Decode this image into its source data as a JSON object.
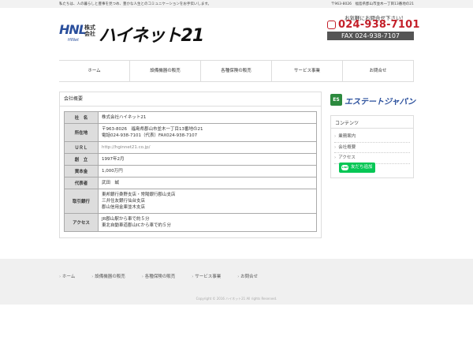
{
  "topbar": {
    "tagline": "私たちは、人の暮らしと豊事を見つめ、豊かな人生とのコミュニケーションをお手伝いします。",
    "address": "〒963-8026　福島県郡山市並木一丁目13番地の21"
  },
  "logo": {
    "mark": "HNL",
    "mark_sub": "HINet",
    "kabushiki": "株式会社",
    "name": "ハイネット21"
  },
  "contact": {
    "note": "お気軽にお問合せ下さい！",
    "phone": "024-938-7101",
    "fax": "FAX 024-938-7107"
  },
  "nav": [
    "ホーム",
    "設備機器の販売",
    "各種保険の販売",
    "サービス事業",
    "お問合せ"
  ],
  "main": {
    "heading": "会社概要",
    "rows": [
      {
        "label": "社　名",
        "lines": [
          "株式会社ハイネット21"
        ]
      },
      {
        "label": "所在地",
        "lines": [
          "〒963-8026　福島県郡山市並木一丁目13番地の21",
          "電話024-938-7101（代表）FAX024-938-7107"
        ]
      },
      {
        "label": "ＵＲＬ",
        "lines": [
          "http://hginnet21.co.jp/"
        ]
      },
      {
        "label": "創　立",
        "lines": [
          "1997年2月"
        ]
      },
      {
        "label": "資本金",
        "lines": [
          "1,000万円"
        ]
      },
      {
        "label": "代表者",
        "lines": [
          "武田　誠"
        ]
      },
      {
        "label": "取引銀行",
        "lines": [
          "東邦銀行桑野支店・常陽銀行郡山支店",
          "三井住友銀行仙台支店",
          "郡山信用金庫並木支店"
        ]
      },
      {
        "label": "アクセス",
        "lines": [
          "JR郡山駅から車で約５分",
          "東北自動車道郡山ICから車で約５分"
        ]
      }
    ]
  },
  "banner": {
    "badge": "ES",
    "text": "エステートジャパン",
    "small": "株式会社"
  },
  "side": {
    "title": "コンテンツ",
    "items": [
      "業務案内",
      "会社概要",
      "アクセス"
    ],
    "line_button": "友だち追加",
    "line_logo": "LINE"
  },
  "footer": {
    "nav": [
      "ホーム",
      "設備機器の販売",
      "各種保険の販売",
      "サービス事業",
      "お問合せ"
    ],
    "copyright": "Copyright © 2016 ハイネット21 All rights Reserved."
  },
  "colors": {
    "phone": "#c4202a",
    "logo_blue": "#2a4f9c",
    "line_green": "#06c755"
  }
}
